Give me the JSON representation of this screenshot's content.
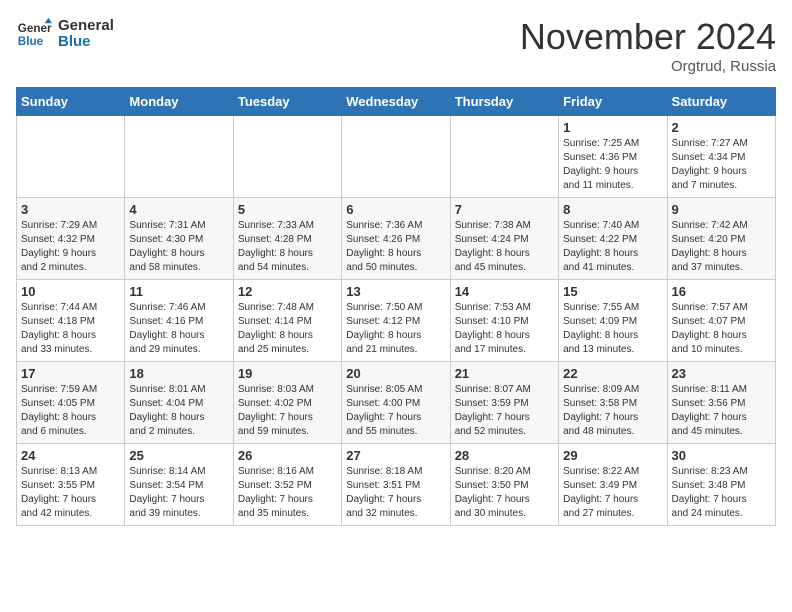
{
  "header": {
    "logo_line1": "General",
    "logo_line2": "Blue",
    "month": "November 2024",
    "location": "Orgtrud, Russia"
  },
  "days_of_week": [
    "Sunday",
    "Monday",
    "Tuesday",
    "Wednesday",
    "Thursday",
    "Friday",
    "Saturday"
  ],
  "weeks": [
    [
      {
        "day": "",
        "info": ""
      },
      {
        "day": "",
        "info": ""
      },
      {
        "day": "",
        "info": ""
      },
      {
        "day": "",
        "info": ""
      },
      {
        "day": "",
        "info": ""
      },
      {
        "day": "1",
        "info": "Sunrise: 7:25 AM\nSunset: 4:36 PM\nDaylight: 9 hours\nand 11 minutes."
      },
      {
        "day": "2",
        "info": "Sunrise: 7:27 AM\nSunset: 4:34 PM\nDaylight: 9 hours\nand 7 minutes."
      }
    ],
    [
      {
        "day": "3",
        "info": "Sunrise: 7:29 AM\nSunset: 4:32 PM\nDaylight: 9 hours\nand 2 minutes."
      },
      {
        "day": "4",
        "info": "Sunrise: 7:31 AM\nSunset: 4:30 PM\nDaylight: 8 hours\nand 58 minutes."
      },
      {
        "day": "5",
        "info": "Sunrise: 7:33 AM\nSunset: 4:28 PM\nDaylight: 8 hours\nand 54 minutes."
      },
      {
        "day": "6",
        "info": "Sunrise: 7:36 AM\nSunset: 4:26 PM\nDaylight: 8 hours\nand 50 minutes."
      },
      {
        "day": "7",
        "info": "Sunrise: 7:38 AM\nSunset: 4:24 PM\nDaylight: 8 hours\nand 45 minutes."
      },
      {
        "day": "8",
        "info": "Sunrise: 7:40 AM\nSunset: 4:22 PM\nDaylight: 8 hours\nand 41 minutes."
      },
      {
        "day": "9",
        "info": "Sunrise: 7:42 AM\nSunset: 4:20 PM\nDaylight: 8 hours\nand 37 minutes."
      }
    ],
    [
      {
        "day": "10",
        "info": "Sunrise: 7:44 AM\nSunset: 4:18 PM\nDaylight: 8 hours\nand 33 minutes."
      },
      {
        "day": "11",
        "info": "Sunrise: 7:46 AM\nSunset: 4:16 PM\nDaylight: 8 hours\nand 29 minutes."
      },
      {
        "day": "12",
        "info": "Sunrise: 7:48 AM\nSunset: 4:14 PM\nDaylight: 8 hours\nand 25 minutes."
      },
      {
        "day": "13",
        "info": "Sunrise: 7:50 AM\nSunset: 4:12 PM\nDaylight: 8 hours\nand 21 minutes."
      },
      {
        "day": "14",
        "info": "Sunrise: 7:53 AM\nSunset: 4:10 PM\nDaylight: 8 hours\nand 17 minutes."
      },
      {
        "day": "15",
        "info": "Sunrise: 7:55 AM\nSunset: 4:09 PM\nDaylight: 8 hours\nand 13 minutes."
      },
      {
        "day": "16",
        "info": "Sunrise: 7:57 AM\nSunset: 4:07 PM\nDaylight: 8 hours\nand 10 minutes."
      }
    ],
    [
      {
        "day": "17",
        "info": "Sunrise: 7:59 AM\nSunset: 4:05 PM\nDaylight: 8 hours\nand 6 minutes."
      },
      {
        "day": "18",
        "info": "Sunrise: 8:01 AM\nSunset: 4:04 PM\nDaylight: 8 hours\nand 2 minutes."
      },
      {
        "day": "19",
        "info": "Sunrise: 8:03 AM\nSunset: 4:02 PM\nDaylight: 7 hours\nand 59 minutes."
      },
      {
        "day": "20",
        "info": "Sunrise: 8:05 AM\nSunset: 4:00 PM\nDaylight: 7 hours\nand 55 minutes."
      },
      {
        "day": "21",
        "info": "Sunrise: 8:07 AM\nSunset: 3:59 PM\nDaylight: 7 hours\nand 52 minutes."
      },
      {
        "day": "22",
        "info": "Sunrise: 8:09 AM\nSunset: 3:58 PM\nDaylight: 7 hours\nand 48 minutes."
      },
      {
        "day": "23",
        "info": "Sunrise: 8:11 AM\nSunset: 3:56 PM\nDaylight: 7 hours\nand 45 minutes."
      }
    ],
    [
      {
        "day": "24",
        "info": "Sunrise: 8:13 AM\nSunset: 3:55 PM\nDaylight: 7 hours\nand 42 minutes."
      },
      {
        "day": "25",
        "info": "Sunrise: 8:14 AM\nSunset: 3:54 PM\nDaylight: 7 hours\nand 39 minutes."
      },
      {
        "day": "26",
        "info": "Sunrise: 8:16 AM\nSunset: 3:52 PM\nDaylight: 7 hours\nand 35 minutes."
      },
      {
        "day": "27",
        "info": "Sunrise: 8:18 AM\nSunset: 3:51 PM\nDaylight: 7 hours\nand 32 minutes."
      },
      {
        "day": "28",
        "info": "Sunrise: 8:20 AM\nSunset: 3:50 PM\nDaylight: 7 hours\nand 30 minutes."
      },
      {
        "day": "29",
        "info": "Sunrise: 8:22 AM\nSunset: 3:49 PM\nDaylight: 7 hours\nand 27 minutes."
      },
      {
        "day": "30",
        "info": "Sunrise: 8:23 AM\nSunset: 3:48 PM\nDaylight: 7 hours\nand 24 minutes."
      }
    ]
  ]
}
